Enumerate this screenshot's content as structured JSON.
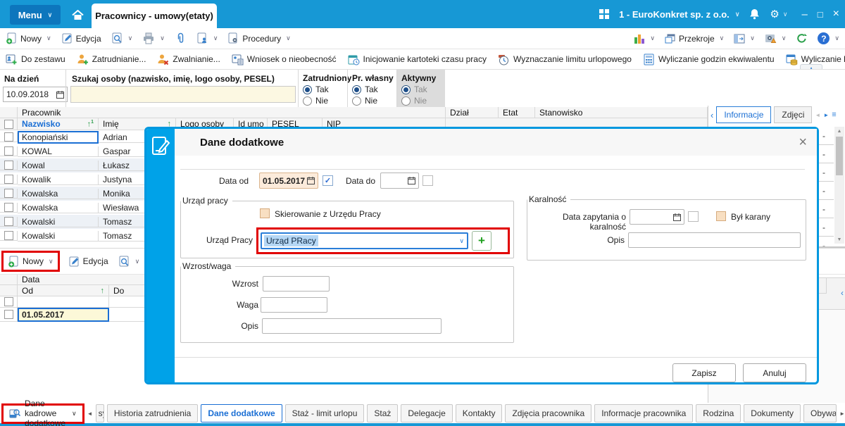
{
  "topbar": {
    "menu": "Menu",
    "tab": "Pracownicy - umowy(etaty)",
    "company": "1 - EuroKonkret sp. z o.o."
  },
  "toolbar1": {
    "nowy": "Nowy",
    "edycja": "Edycja",
    "procedury": "Procedury",
    "przekroje": "Przekroje"
  },
  "toolbar2": {
    "items": [
      "Do zestawu",
      "Zatrudnianie...",
      "Zwalnianie...",
      "Wniosek o nieobecność",
      "Inicjowanie kartoteki czasu pracy",
      "Wyznaczanie limitu urlopowego",
      "Wyliczanie godzin ekwiwalentu",
      "Wyliczanie kwoty ekwiwalentu"
    ]
  },
  "filters": {
    "na_dzien": {
      "label": "Na dzień",
      "value": "10.09.2018"
    },
    "szukaj": {
      "label": "Szukaj osoby (nazwisko, imię, logo osoby, PESEL)",
      "value": ""
    },
    "zatrudniony": {
      "label": "Zatrudniony",
      "tak": "Tak",
      "nie": "Nie",
      "selected": "Tak"
    },
    "pr_wlasny": {
      "label": "Pr. własny",
      "tak": "Tak",
      "nie": "Nie",
      "selected": "Tak"
    },
    "aktywny": {
      "label": "Aktywny",
      "tak": "Tak",
      "nie": "Nie",
      "selected": "Tak"
    }
  },
  "grid": {
    "group": "Pracownik",
    "cols": {
      "nazwisko": "Nazwisko",
      "imie": "Imię",
      "logo": "Logo osoby",
      "id_umo": "Id umo",
      "pesel": "PESEL",
      "nip": "NIP",
      "dzial": "Dział",
      "etat": "Etat",
      "stanowisko": "Stanowisko"
    },
    "rows": [
      {
        "nazwisko": "Konopiański",
        "imie": "Adrian"
      },
      {
        "nazwisko": "KOWAL",
        "imie": "Gaspar"
      },
      {
        "nazwisko": "Kowal",
        "imie": "Łukasz"
      },
      {
        "nazwisko": "Kowalik",
        "imie": "Justyna"
      },
      {
        "nazwisko": "Kowalska",
        "imie": "Monika"
      },
      {
        "nazwisko": "Kowalska",
        "imie": "Wiesława"
      },
      {
        "nazwisko": "Kowalski",
        "imie": "Tomasz"
      },
      {
        "nazwisko": "Kowalski",
        "imie": "Tomasz"
      }
    ]
  },
  "detail": {
    "toolbar": {
      "nowy": "Nowy",
      "edycja": "Edycja"
    },
    "grid": {
      "group": "Data",
      "od": "Od",
      "do": "Do",
      "rows": [
        {
          "od": "01.05.2017",
          "do": ""
        }
      ]
    }
  },
  "right_panel": {
    "tabs": [
      "Informacje",
      "Zdjęci"
    ]
  },
  "bottom": {
    "selector": "Dane kadrowe dodatkowe",
    "partial_tab": "sy",
    "tabs": [
      "Historia zatrudnienia",
      "Dane dodatkowe",
      "Staż - limit urlopu",
      "Staż",
      "Delegacje",
      "Kontakty",
      "Zdjęcia pracownika",
      "Informacje pracownika",
      "Rodzina",
      "Dokumenty",
      "Obywatelstwa"
    ],
    "active": "Dane dodatkowe"
  },
  "modal": {
    "title": "Dane dodatkowe",
    "data_od": {
      "label": "Data od",
      "value": "01.05.2017"
    },
    "data_do": {
      "label": "Data do",
      "value": ""
    },
    "urzad": {
      "title": "Urząd pracy",
      "skierowanie": "Skierowanie z Urzędu Pracy",
      "combo_label": "Urząd Pracy",
      "combo_value": "Urząd PRacy"
    },
    "karalnosc": {
      "title": "Karalność",
      "data_label": "Data zapytania o karalność",
      "byl_karany": "Był karany",
      "opis_label": "Opis"
    },
    "wzrost": {
      "title": "Wzrost/waga",
      "wzrost_label": "Wzrost",
      "waga_label": "Waga",
      "opis_label": "Opis"
    },
    "zapisz": "Zapisz",
    "anuluj": "Anuluj"
  },
  "glyphs": {
    "chev_down": "∨",
    "chev_up": "∧",
    "chev_left": "‹",
    "arrow_left": "◄",
    "arrow_right": "►",
    "tri_up": "▲",
    "tri_down": "▼",
    "close": "×",
    "minimize": "–",
    "maximize": "□",
    "help": "?",
    "check": "✓",
    "sort_asc": "↑",
    "sort_num": "1",
    "gear": "⚙",
    "menu_list": "≡",
    "dash": "-",
    "plus": "+"
  },
  "colors": {
    "accent_blue": "#1798d5",
    "highlight_red": "#e10000",
    "modal_stripe": "#00a2e8"
  }
}
